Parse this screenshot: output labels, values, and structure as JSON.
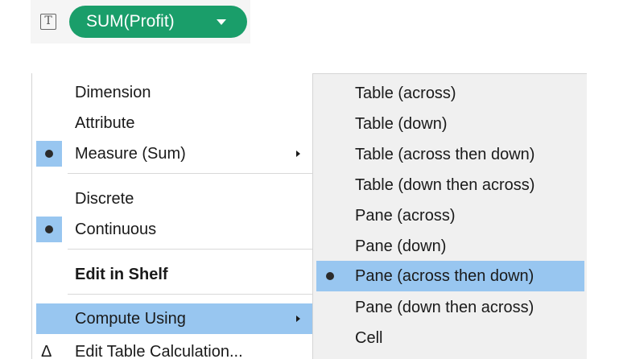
{
  "pill": {
    "type_icon": "T",
    "label": "SUM(Profit)"
  },
  "menu": {
    "items": [
      {
        "label": "Dimension"
      },
      {
        "label": "Attribute"
      },
      {
        "label": "Measure (Sum)"
      },
      {
        "label": "Discrete"
      },
      {
        "label": "Continuous"
      },
      {
        "label": "Edit in Shelf"
      },
      {
        "label": "Compute Using"
      },
      {
        "label": "Edit Table Calculation...",
        "icon": "Δ"
      }
    ]
  },
  "submenu": {
    "items": [
      {
        "label": "Table (across)"
      },
      {
        "label": "Table (down)"
      },
      {
        "label": "Table (across then down)"
      },
      {
        "label": "Table (down then across)"
      },
      {
        "label": "Pane (across)"
      },
      {
        "label": "Pane (down)"
      },
      {
        "label": "Pane (across then down)"
      },
      {
        "label": "Pane (down then across)"
      },
      {
        "label": "Cell"
      }
    ]
  },
  "colors": {
    "pill": "#1a9e6a",
    "highlight": "#98c6f0",
    "submenu_bg": "#f0f0f0"
  }
}
